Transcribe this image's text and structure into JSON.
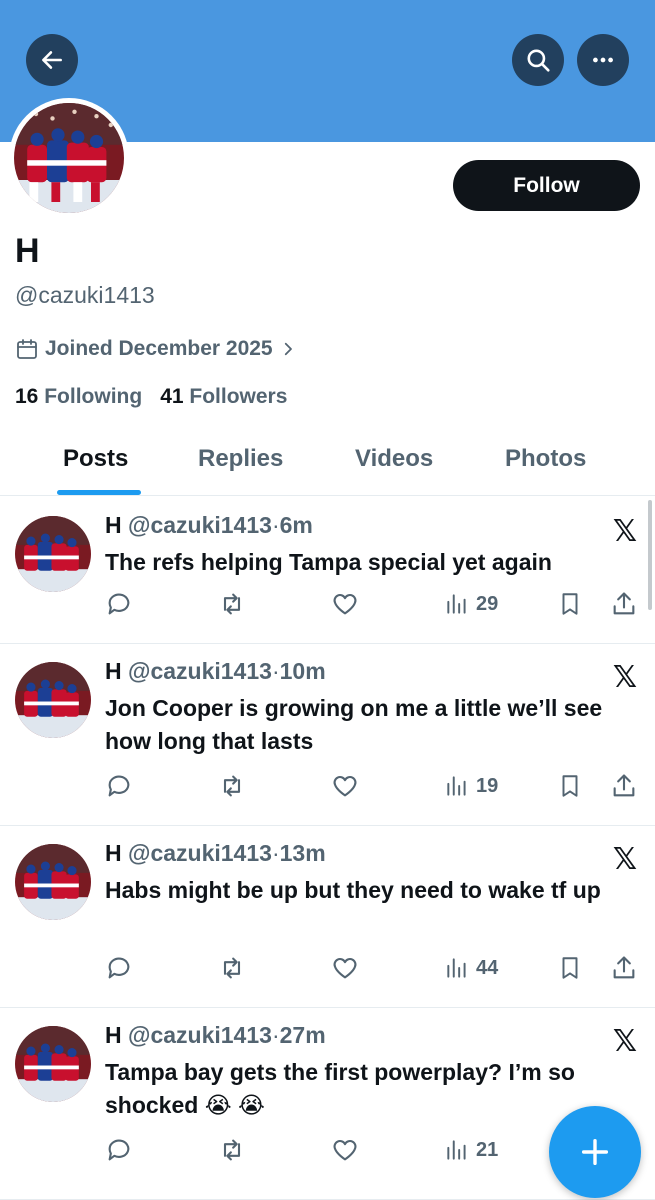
{
  "profile": {
    "name": "H",
    "handle": "@cazuki1413",
    "joined": "Joined December 2025",
    "following_count": "16",
    "following_label": "Following",
    "followers_count": "41",
    "followers_label": "Followers",
    "follow_button": "Follow"
  },
  "tabs": [
    {
      "label": "Posts",
      "active": true
    },
    {
      "label": "Replies"
    },
    {
      "label": "Videos"
    },
    {
      "label": "Photos"
    }
  ],
  "posts": [
    {
      "name": "H",
      "handle": "@cazuki1413",
      "sep": "·",
      "time": "6m",
      "text": "The refs helping Tampa special yet again",
      "views": "29"
    },
    {
      "name": "H",
      "handle": "@cazuki1413",
      "sep": "·",
      "time": "10m",
      "text": "Jon Cooper is growing on me a little we’ll see how long that lasts",
      "views": "19"
    },
    {
      "name": "H",
      "handle": "@cazuki1413",
      "sep": "·",
      "time": "13m",
      "text": "Habs might be up but they need to wake tf up",
      "views": "44"
    },
    {
      "name": "H",
      "handle": "@cazuki1413",
      "sep": "·",
      "time": "27m",
      "text": "Tampa bay gets the first powerplay? I’m so shocked 😭 😭",
      "views": "21"
    }
  ],
  "icons": {
    "back": "arrow-left-icon",
    "search": "search-icon",
    "more": "more-icon",
    "calendar": "calendar-icon",
    "x_logo": "𝕏",
    "compose": "plus-icon"
  },
  "colors": {
    "banner": "#4a97e0",
    "accent": "#1d9bf0",
    "text": "#0f1419",
    "muted": "#536471"
  }
}
